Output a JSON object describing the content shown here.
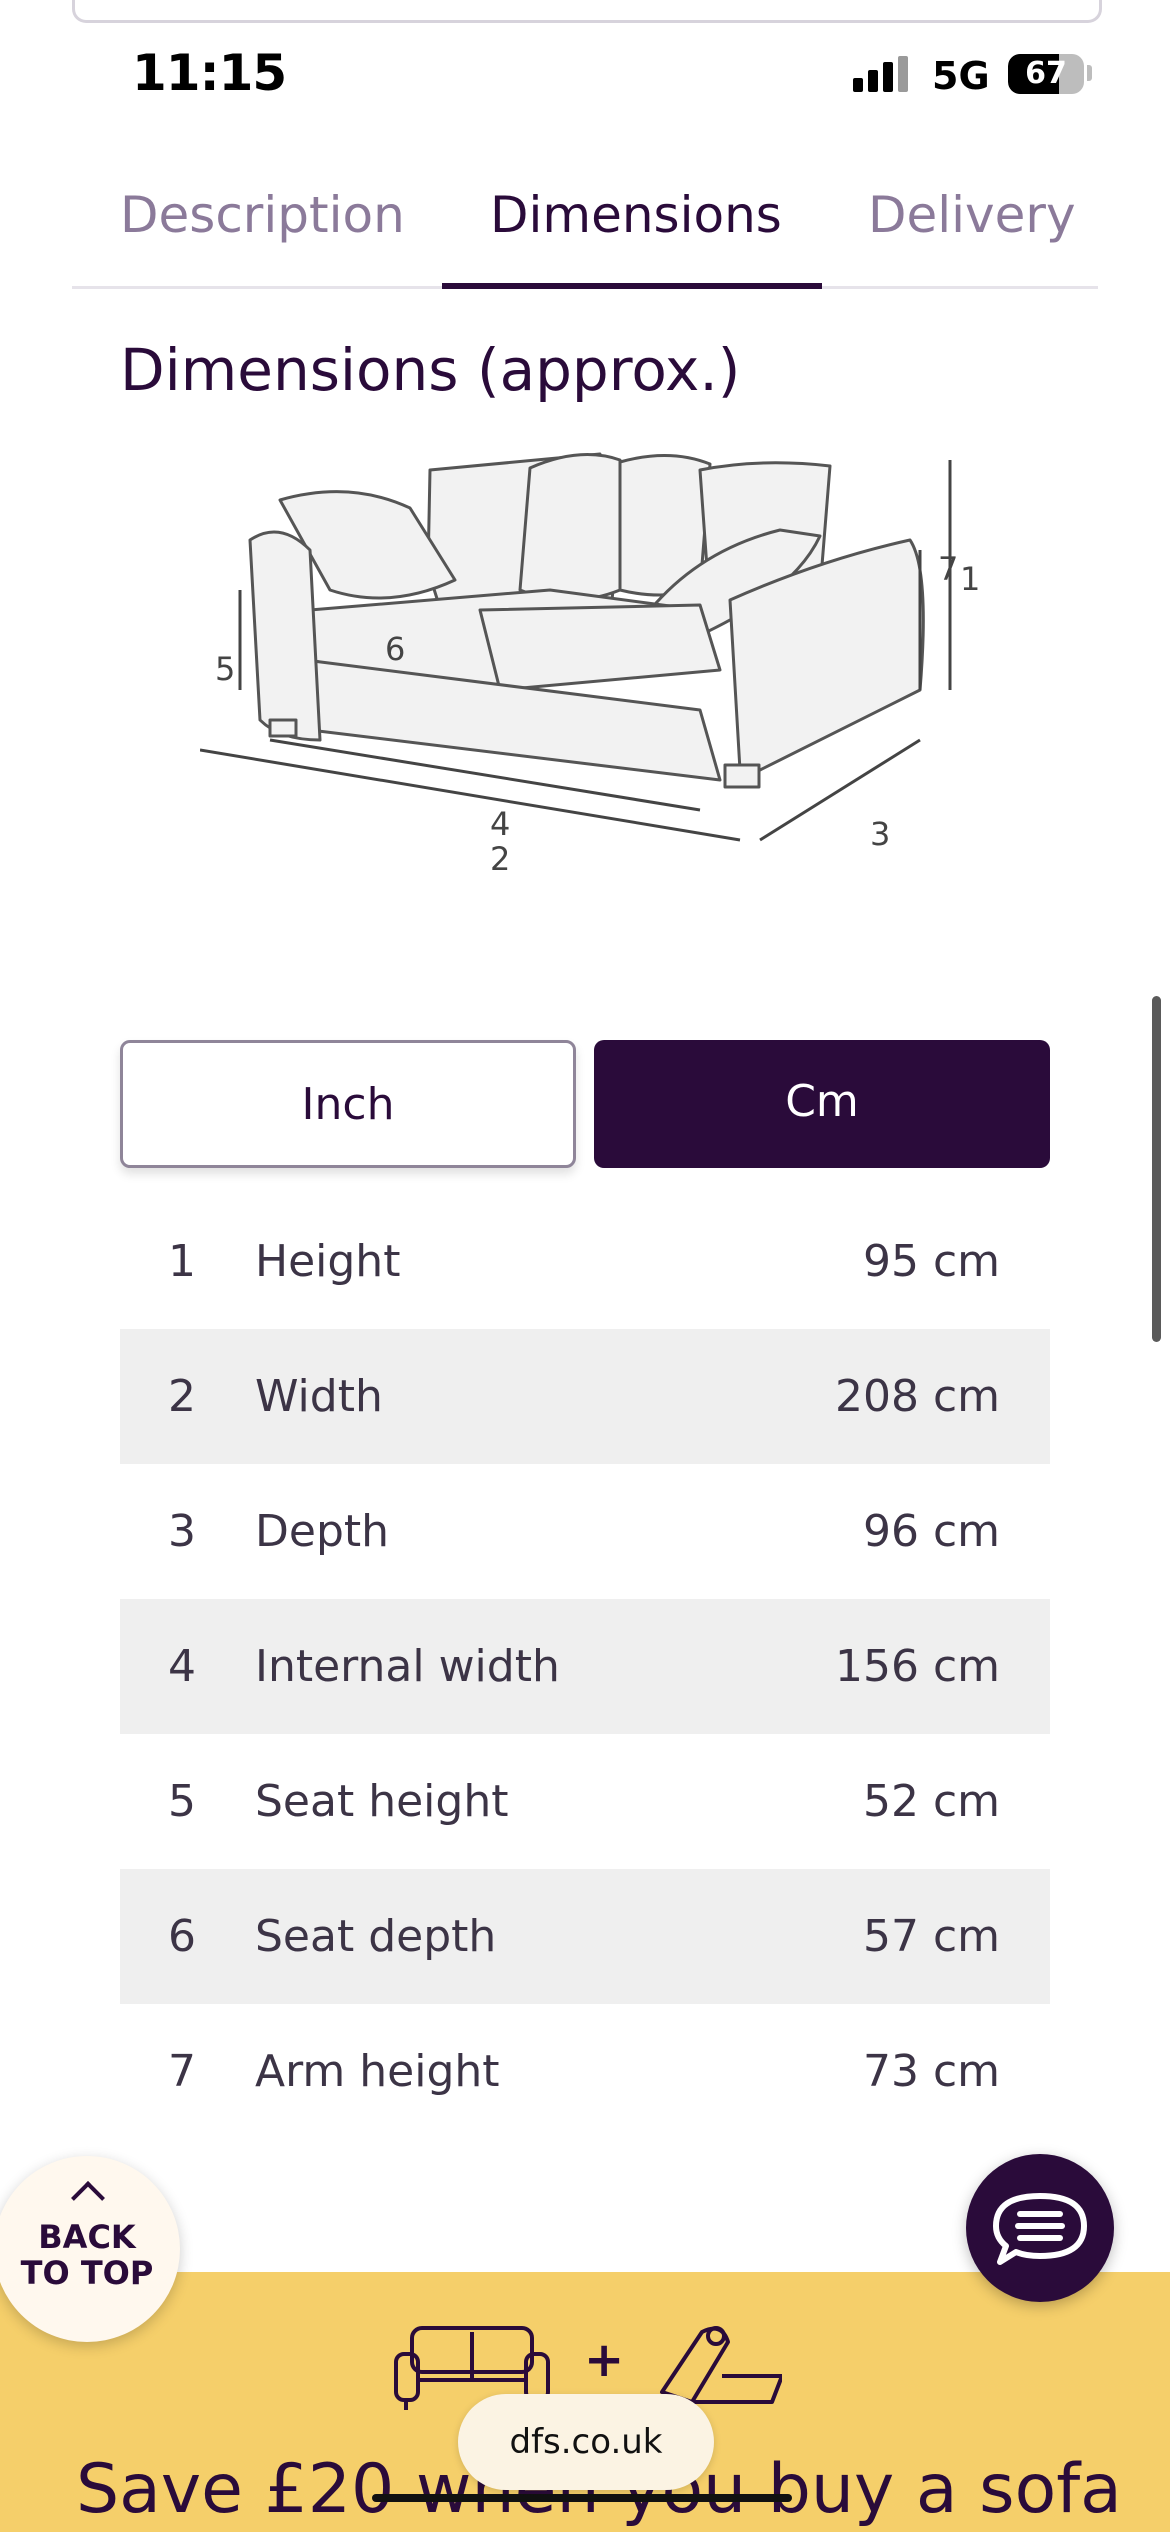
{
  "status_bar": {
    "time": "11:15",
    "network": "5G",
    "battery_percent": 67,
    "battery_label": "67"
  },
  "tabs": [
    {
      "label": "Description",
      "active": false
    },
    {
      "label": "Dimensions",
      "active": true
    },
    {
      "label": "Delivery",
      "active": false
    }
  ],
  "section_title": "Dimensions (approx.)",
  "diagram_labels": [
    "1",
    "2",
    "3",
    "4",
    "5",
    "6",
    "7"
  ],
  "units": {
    "inch_label": "Inch",
    "cm_label": "Cm",
    "selected": "Cm"
  },
  "dimensions": [
    {
      "num": "1",
      "label": "Height",
      "value": "95 cm"
    },
    {
      "num": "2",
      "label": "Width",
      "value": "208 cm"
    },
    {
      "num": "3",
      "label": "Depth",
      "value": "96 cm"
    },
    {
      "num": "4",
      "label": "Internal width",
      "value": "156 cm"
    },
    {
      "num": "5",
      "label": "Seat height",
      "value": "52 cm"
    },
    {
      "num": "6",
      "label": "Seat depth",
      "value": "57 cm"
    },
    {
      "num": "7",
      "label": "Arm height",
      "value": "73 cm"
    }
  ],
  "back_to_top": {
    "line1": "BACK",
    "line2": "TO TOP"
  },
  "promo": {
    "plus": "+",
    "text": "Save £20 when you buy a sofa"
  },
  "url": "dfs.co.uk",
  "colors": {
    "brand_purple": "#2a0b3a",
    "muted_purple": "#8b7a9a",
    "promo_yellow": "#f5cf6a",
    "row_shade": "#efefef"
  }
}
